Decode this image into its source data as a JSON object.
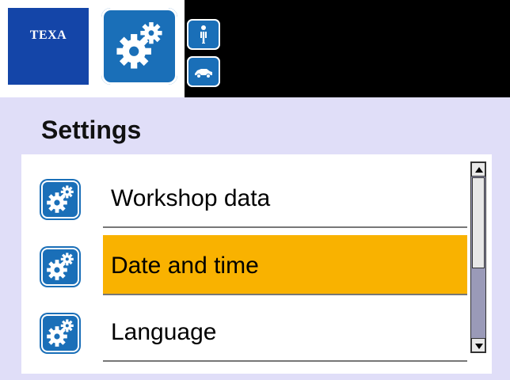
{
  "brand": {
    "logo_text": "TEXA"
  },
  "header": {
    "active_tab_icon": "gear-icon",
    "side_tabs": [
      {
        "icon": "person-icon"
      },
      {
        "icon": "car-icon"
      }
    ]
  },
  "page": {
    "title": "Settings"
  },
  "menu": {
    "items": [
      {
        "label": "Workshop data",
        "icon": "gear-icon",
        "selected": false
      },
      {
        "label": "Date and time",
        "icon": "gear-icon",
        "selected": true
      },
      {
        "label": "Language",
        "icon": "gear-icon",
        "selected": false
      }
    ]
  },
  "colors": {
    "accent": "#1a6fb8",
    "logo_bg": "#1445a8",
    "selection": "#f9b200",
    "background": "#e0def8"
  }
}
